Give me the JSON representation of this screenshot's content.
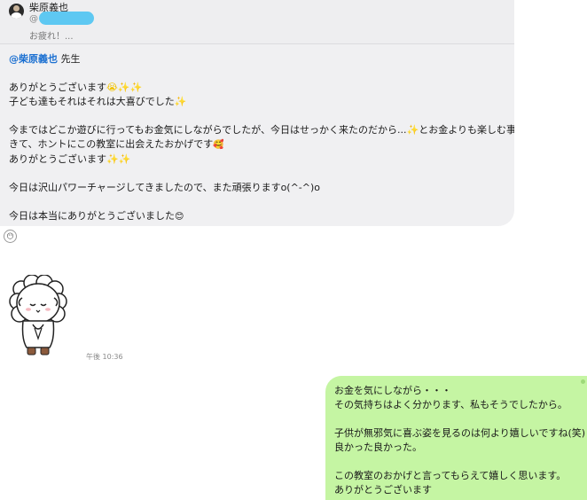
{
  "quote": {
    "sender": "柴原義也",
    "at_symbol": "@",
    "snippet": "お疲れ！..."
  },
  "incoming": {
    "mention": "@柴原義也",
    "mention_suffix": " 先生",
    "line1": "ありがとうございます",
    "line1_emoji": "😭✨✨",
    "line2": "子ども達もそれはそれは大喜びでした",
    "line2_emoji": "✨",
    "line3a": "今まではどこか遊びに行ってもお金気にしながらでしたが、今日はせっかく来たのだから...",
    "line3a_emoji": "✨",
    "line3b": "とお金よりも楽しむ事を優先で",
    "line4": "きて、ホントにこの教室に出会えたおかげです",
    "line4_emoji": "🥰",
    "line5": "ありがとうございます",
    "line5_emoji": "✨✨",
    "line6": "今日は沢山パワーチャージしてきましたので、また頑張りますo(^-^)o",
    "line7": "今日は本当にありがとうございました",
    "line7_emoji": "😊",
    "reaction_icon": "smiley-icon",
    "reaction_glyph": "😶"
  },
  "sticker": {
    "icon": "sheep-bowing-sticker",
    "timestamp": "午後 10:36"
  },
  "outgoing": {
    "line1": "お金を気にしながら・・・",
    "line2": "その気持ちはよく分かります、私もそうでしたから。",
    "line3": "子供が無邪気に喜ぶ姿を見るのは何より嬉しいですね(笑)",
    "line4": "良かった良かった。",
    "line5": "この教室のおかげと言ってもらえて嬉しく思います。",
    "line6": "ありがとうございます"
  },
  "colors": {
    "incoming_bubble": "#f0f0f2",
    "outgoing_bubble": "#c5f5a3",
    "mention": "#1a6fd1",
    "redaction": "#5ec8f2"
  }
}
